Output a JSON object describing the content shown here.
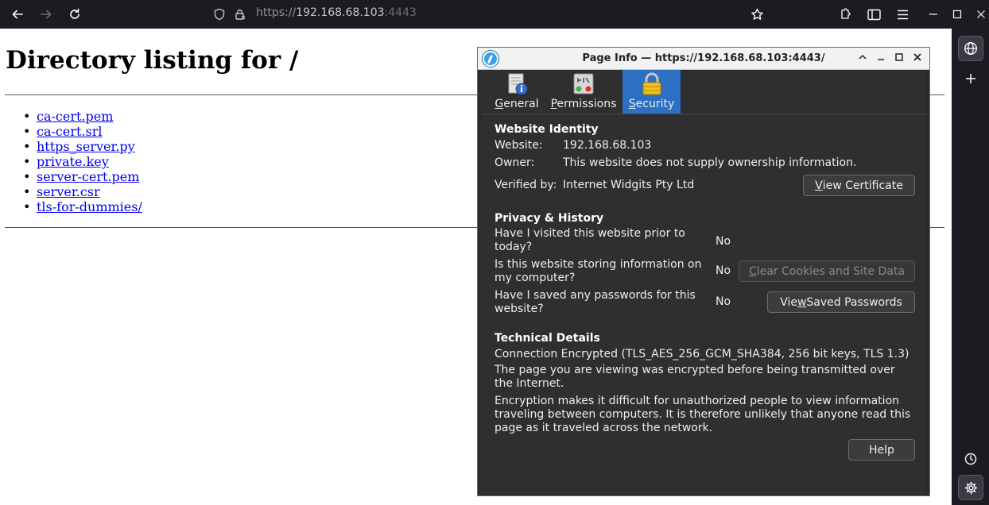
{
  "browser": {
    "url_scheme": "https://",
    "url_host": "192.168.68.103",
    "url_port": ":4443"
  },
  "page": {
    "heading": "Directory listing for /",
    "files": [
      "ca-cert.pem",
      "ca-cert.srl",
      "https_server.py",
      "private.key",
      "server-cert.pem",
      "server.csr",
      "tls-for-dummies/"
    ]
  },
  "dialog": {
    "title": "Page Info — https://192.168.68.103:4443/",
    "tabs": [
      {
        "label": "General",
        "access_key": "G",
        "rest": "eneral"
      },
      {
        "label": "Permissions",
        "access_key": "P",
        "rest": "ermissions"
      },
      {
        "label": "Security",
        "access_key": "S",
        "rest": "ecurity"
      }
    ],
    "identity": {
      "title": "Website Identity",
      "website_label": "Website:",
      "website_value": "192.168.68.103",
      "owner_label": "Owner:",
      "owner_value": "This website does not supply ownership information.",
      "verified_label": "Verified by:",
      "verified_value": "Internet Widgits Pty Ltd",
      "view_cert_key": "V",
      "view_cert_rest": "iew Certificate"
    },
    "privacy": {
      "title": "Privacy & History",
      "q1": "Have I visited this website prior to today?",
      "a1": "No",
      "q2": "Is this website storing information on my computer?",
      "a2": "No",
      "clear_key": "C",
      "clear_rest": "lear Cookies and Site Data",
      "q3": "Have I saved any passwords for this website?",
      "a3": "No",
      "saved_pre": "Vie",
      "saved_key": "w",
      "saved_rest": " Saved Passwords"
    },
    "technical": {
      "title": "Technical Details",
      "connection": "Connection Encrypted (TLS_AES_256_GCM_SHA384, 256 bit keys, TLS 1.3)",
      "para1": "The page you are viewing was encrypted before being transmitted over the Internet.",
      "para2": "Encryption makes it difficult for unauthorized people to view information traveling between computers. It is therefore unlikely that anyone read this page as it traveled across the network."
    },
    "help_label": "Help"
  },
  "colors": {
    "link": "#0000ee",
    "selected_tab": "#2d6fc2",
    "dialog_bg": "#2f2f2f"
  }
}
